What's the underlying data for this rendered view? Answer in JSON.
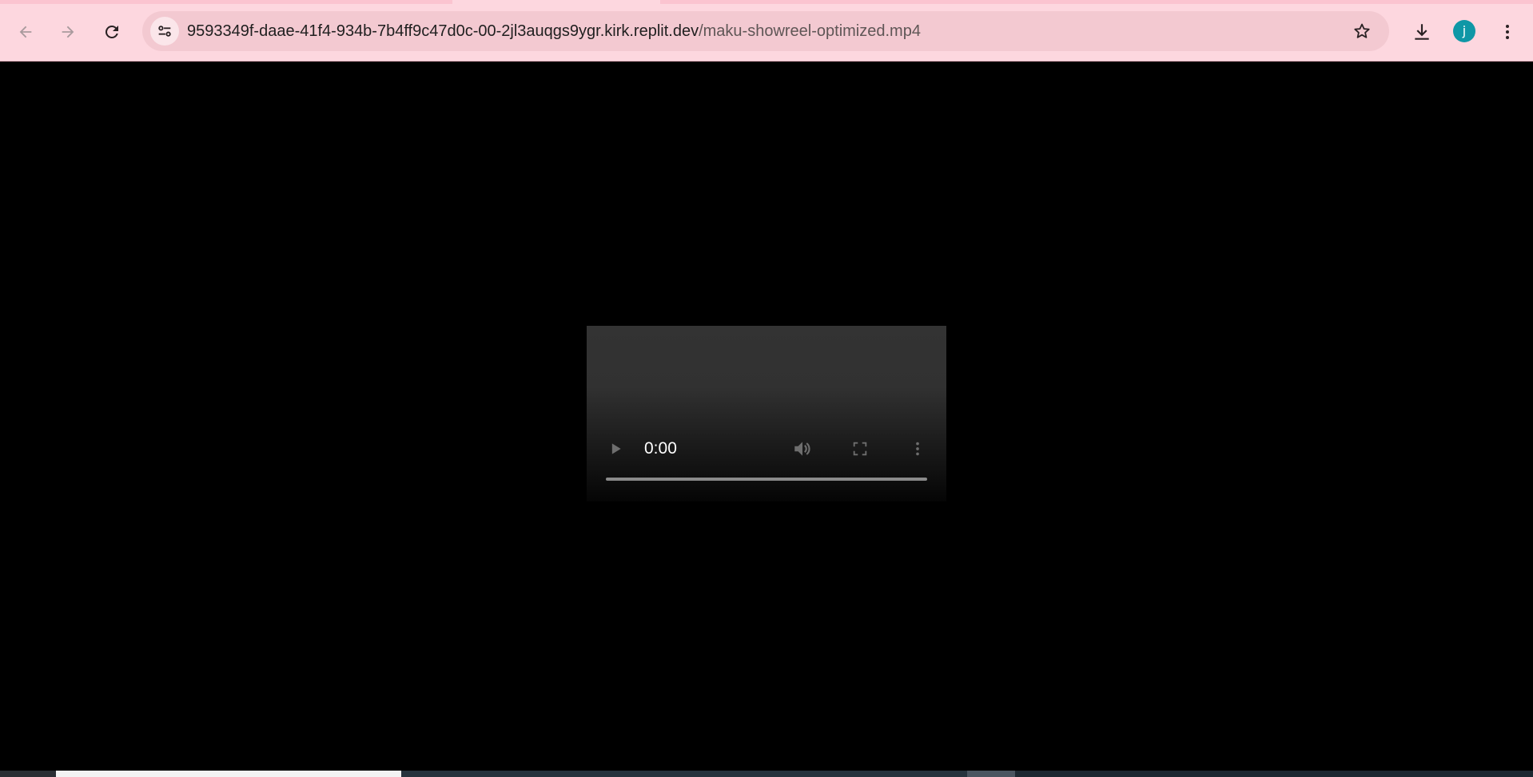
{
  "browser": {
    "url_host": "9593349f-daae-41f4-934b-7b4ff9c47d0c-00-2jl3auqgs9ygr.kirk.replit.dev",
    "url_path": "/maku-showreel-optimized.mp4",
    "profile_initial": "j",
    "profile_color": "#0f97a6",
    "theme_color": "#fdd7df",
    "icons": {
      "back": "arrow-left-icon",
      "forward": "arrow-right-icon",
      "reload": "reload-icon",
      "site_info": "tune-icon",
      "bookmark": "star-icon",
      "downloads": "download-icon",
      "menu": "kebab-menu-icon"
    }
  },
  "video": {
    "current_time": "0:00",
    "progress_fraction": 0,
    "icons": {
      "play": "play-icon",
      "volume": "volume-icon",
      "fullscreen": "fullscreen-icon",
      "more": "more-options-icon"
    }
  }
}
